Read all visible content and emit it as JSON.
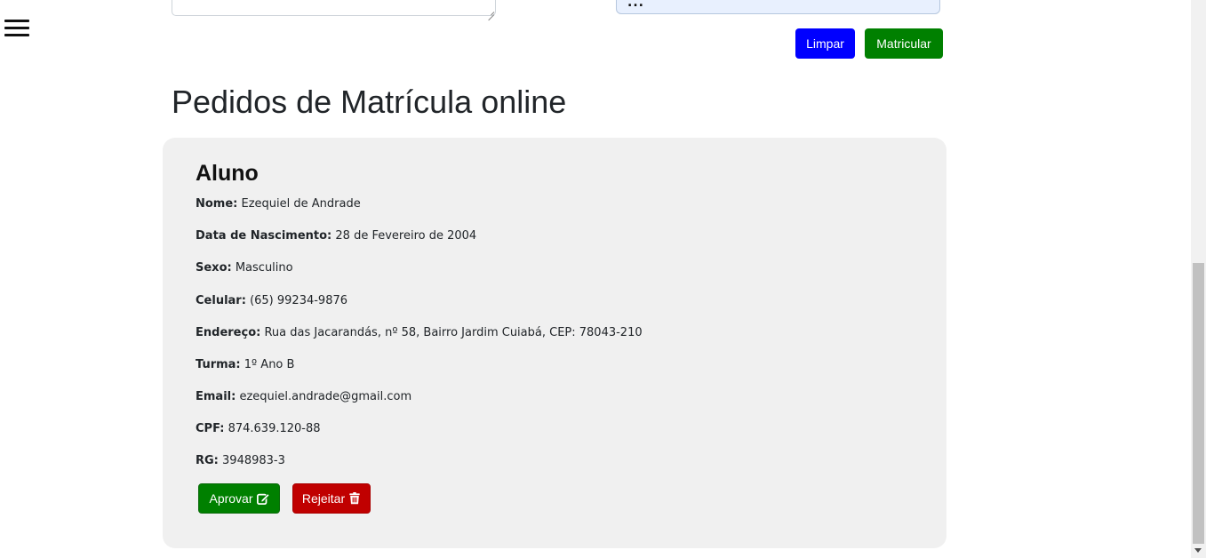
{
  "top_form": {
    "select_value_partial": "...",
    "clear_label": "Limpar",
    "enroll_label": "Matricular"
  },
  "section": {
    "title": "Pedidos de Matrícula online"
  },
  "student_card": {
    "title": "Aluno",
    "fields": [
      {
        "label": "Nome:",
        "value": "Ezequiel de Andrade"
      },
      {
        "label": "Data de Nascimento:",
        "value": "28 de Fevereiro de 2004"
      },
      {
        "label": "Sexo:",
        "value": "Masculino"
      },
      {
        "label": "Celular:",
        "value": "(65) 99234-9876"
      },
      {
        "label": "Endereço:",
        "value": "Rua das Jacarandás, nº 58, Bairro Jardim Cuiabá, CEP: 78043-210"
      },
      {
        "label": "Turma:",
        "value": "1º Ano B"
      },
      {
        "label": "Email:",
        "value": "ezequiel.andrade@gmail.com"
      },
      {
        "label": "CPF:",
        "value": "874.639.120-88"
      },
      {
        "label": "RG:",
        "value": "3948983-3"
      }
    ],
    "approve_label": "Aprovar",
    "reject_label": "Rejeitar"
  },
  "colors": {
    "primary_blue": "#0000ff",
    "success_green": "#008000",
    "danger_red": "#c00000",
    "card_bg": "#f0f0f0"
  },
  "icons": {
    "menu": "hamburger-icon",
    "approve": "edit-icon",
    "reject": "trash-icon"
  }
}
